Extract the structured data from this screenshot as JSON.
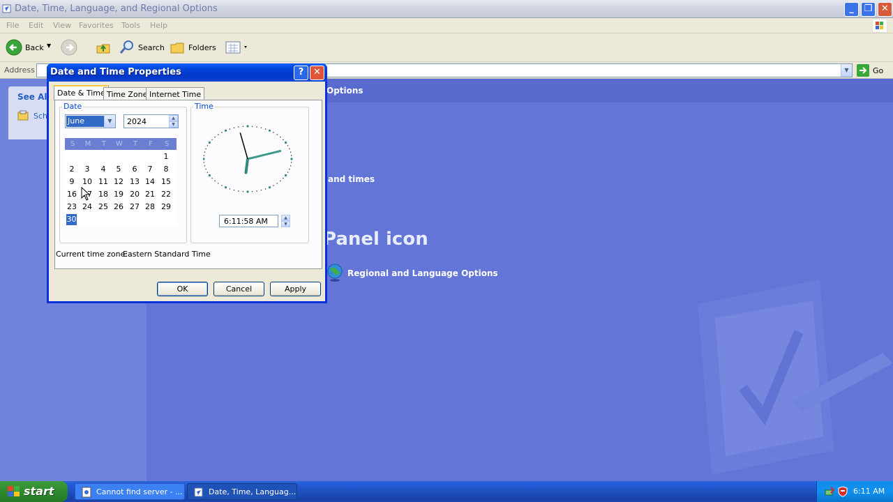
{
  "window": {
    "title": "Date, Time, Language, and Regional Options",
    "menu": [
      "File",
      "Edit",
      "View",
      "Favorites",
      "Tools",
      "Help"
    ],
    "toolbar": {
      "back": "Back",
      "search": "Search",
      "folders": "Folders"
    },
    "address_label": "Address",
    "go_label": "Go"
  },
  "leftpane": {
    "see_also": "See Als",
    "item": "Sch"
  },
  "content": {
    "band_text": "Options",
    "task_text": "and times",
    "heading": "Panel icon",
    "link": "Regional and Language Options"
  },
  "dialog": {
    "title": "Date and Time Properties",
    "tabs": [
      "Date & Time",
      "Time Zone",
      "Internet Time"
    ],
    "date_group": "Date",
    "time_group": "Time",
    "month": "June",
    "year": "2024",
    "dow": [
      "S",
      "M",
      "T",
      "W",
      "T",
      "F",
      "S"
    ],
    "days": [
      "1",
      "2",
      "3",
      "4",
      "5",
      "6",
      "7",
      "8",
      "9",
      "10",
      "11",
      "12",
      "13",
      "14",
      "15",
      "16",
      "17",
      "18",
      "19",
      "20",
      "21",
      "22",
      "23",
      "24",
      "25",
      "26",
      "27",
      "28",
      "29",
      "30"
    ],
    "first_weekday_index": 6,
    "selected_day": "30",
    "time": "6:11:58 AM",
    "clock": {
      "hour": 6,
      "minute": 11,
      "second": 58
    },
    "timezone_label": "Current time zone:",
    "timezone": "Eastern Standard Time",
    "ok": "OK",
    "cancel": "Cancel",
    "apply": "Apply"
  },
  "taskbar": {
    "start": "start",
    "tasks": [
      "Cannot find server - ...",
      "Date, Time, Languag..."
    ],
    "clock": "6:11 AM"
  },
  "colors": {
    "xp_blue": "#0831d9",
    "content_bg": "#6375d6",
    "link": "#ffffff",
    "selection": "#316ac5"
  }
}
